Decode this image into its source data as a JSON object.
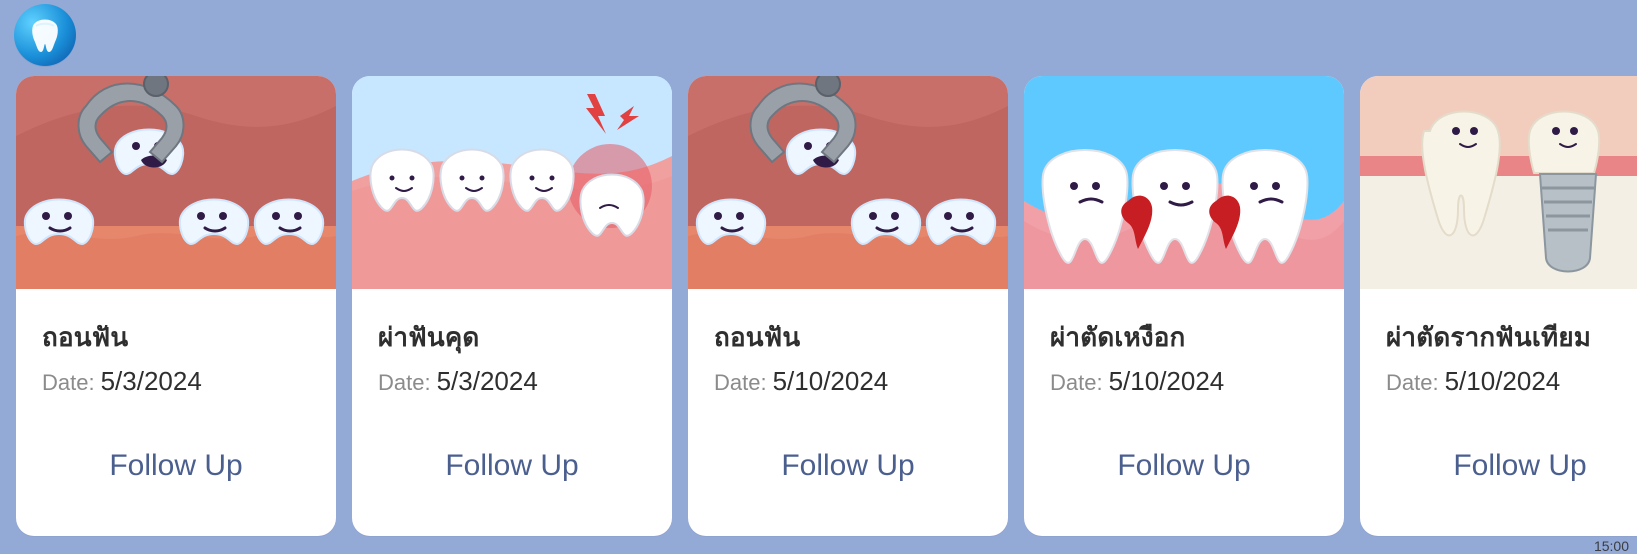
{
  "app": {
    "logo_icon": "tooth-icon",
    "colors": {
      "background": "#93a9d6",
      "card": "#ffffff",
      "link": "#4b5f8f"
    }
  },
  "cards": [
    {
      "title": "ถอนฟัน",
      "date_label": "Date:",
      "date_value": "5/3/2024",
      "action": "Follow Up",
      "illustration_icon": "tooth-extraction-illustration"
    },
    {
      "title": "ผ่าฟันคุด",
      "date_label": "Date:",
      "date_value": "5/3/2024",
      "action": "Follow Up",
      "illustration_icon": "wisdom-tooth-illustration"
    },
    {
      "title": "ถอนฟัน",
      "date_label": "Date:",
      "date_value": "5/10/2024",
      "action": "Follow Up",
      "illustration_icon": "tooth-extraction-illustration"
    },
    {
      "title": "ผ่าตัดเหงือก",
      "date_label": "Date:",
      "date_value": "5/10/2024",
      "action": "Follow Up",
      "illustration_icon": "gum-surgery-illustration"
    },
    {
      "title": "ผ่าตัดรากฟันเทียม",
      "date_label": "Date:",
      "date_value": "5/10/2024",
      "action": "Follow Up",
      "illustration_icon": "dental-implant-illustration"
    }
  ],
  "status": {
    "time": "15:00"
  }
}
